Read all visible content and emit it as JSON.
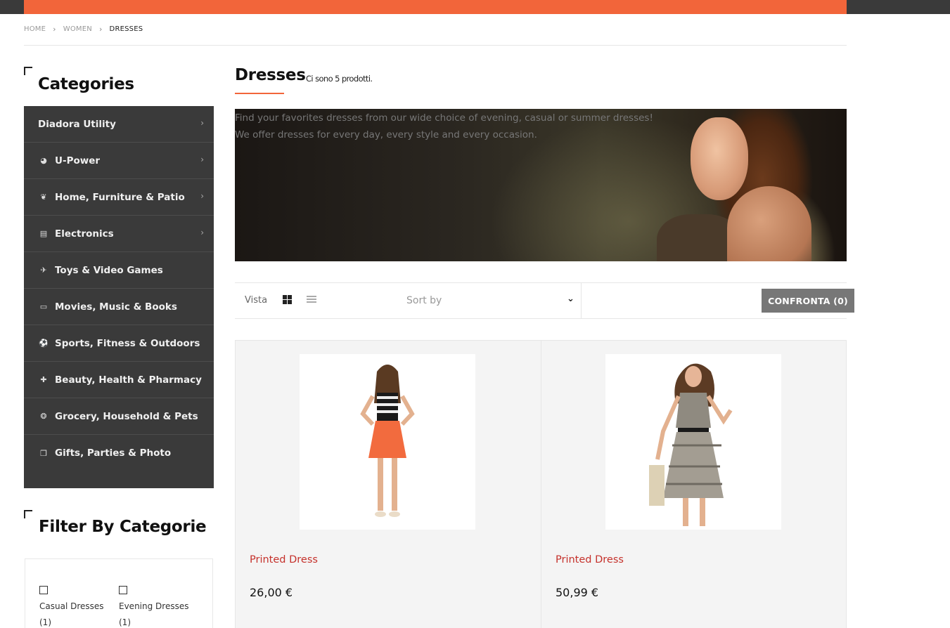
{
  "breadcrumb": {
    "home": "HOME",
    "women": "WOMEN",
    "current": "DRESSES"
  },
  "sidebar": {
    "categories_title": "Categories",
    "categories": [
      {
        "label": "Diadora Utility",
        "icon": "",
        "has_submenu": true
      },
      {
        "label": "U-Power",
        "icon": "gauge-icon",
        "has_submenu": true
      },
      {
        "label": "Home, Furniture & Patio",
        "icon": "leaf-icon",
        "has_submenu": true
      },
      {
        "label": "Electronics",
        "icon": "printer-icon",
        "has_submenu": true
      },
      {
        "label": "Toys & Video Games",
        "icon": "plane-icon",
        "has_submenu": false
      },
      {
        "label": "Movies, Music & Books",
        "icon": "monitor-icon",
        "has_submenu": false
      },
      {
        "label": "Sports, Fitness & Outdoors",
        "icon": "soccer-ball-icon",
        "has_submenu": false
      },
      {
        "label": "Beauty, Health & Pharmacy",
        "icon": "medkit-icon",
        "has_submenu": false
      },
      {
        "label": "Grocery, Household & Pets",
        "icon": "rebel-icon",
        "has_submenu": false
      },
      {
        "label": "Gifts, Parties & Photo",
        "icon": "gift-icon",
        "has_submenu": false
      }
    ],
    "filter_title": "Filter By Categorie",
    "filters": [
      {
        "label": "Casual Dresses",
        "count": "(1)"
      },
      {
        "label": "Evening Dresses",
        "count": "(1)"
      }
    ]
  },
  "main": {
    "title": "Dresses",
    "count_text": "Ci sono 5 prodotti.",
    "banner_line1": "Find your favorites dresses from our wide choice of evening, casual or summer dresses!",
    "banner_line2": "We offer dresses for every day, every style and every occasion.",
    "toolbar": {
      "view_label": "Vista",
      "sort_label": "Sort by",
      "compare_label": "CONFRONTA (0)"
    },
    "products": [
      {
        "name": "Printed Dress",
        "price": "26,00 €"
      },
      {
        "name": "Printed Dress",
        "price": "50,99 €"
      }
    ]
  },
  "colors": {
    "accent": "#f2653a",
    "sidebar_bg": "#3a3a3a",
    "product_name": "#c5312b"
  }
}
